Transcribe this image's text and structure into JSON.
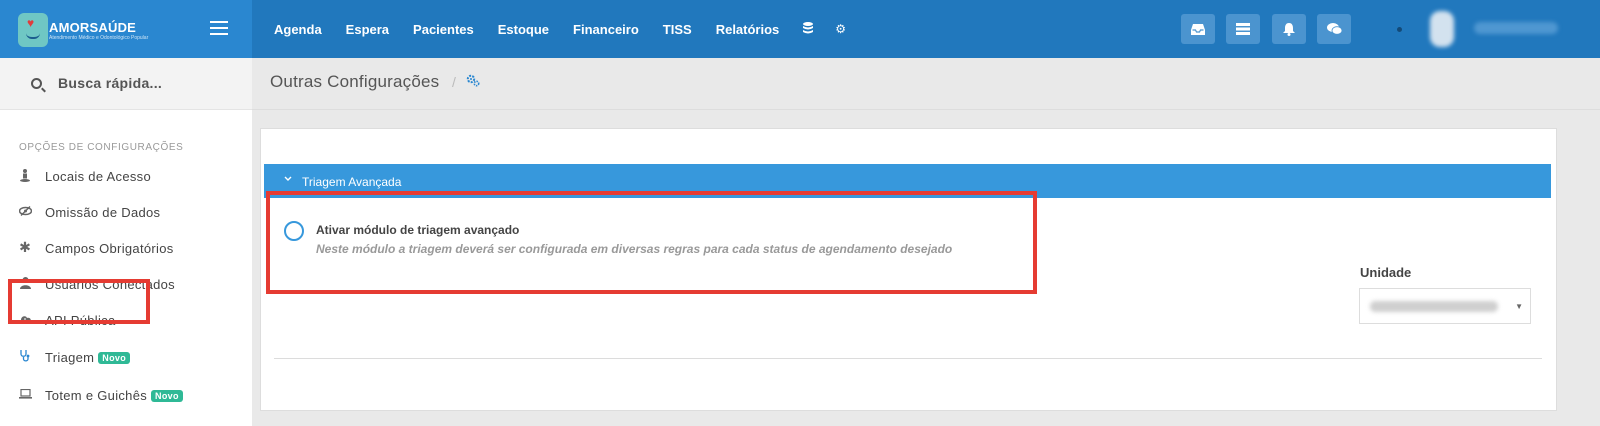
{
  "brand": {
    "name": "AMORSAÚDE",
    "subtitle": "Atendimento Médico e Odontológico Popular"
  },
  "nav": {
    "items": [
      "Agenda",
      "Espera",
      "Pacientes",
      "Estoque",
      "Financeiro",
      "TISS",
      "Relatórios"
    ],
    "icons": [
      "database-icon",
      "gear-icon"
    ]
  },
  "toolbar": {
    "buttons": [
      "inbox-icon",
      "server-icon",
      "bell-icon",
      "chat-icon"
    ]
  },
  "sidebar": {
    "search_label": "Busca rápida...",
    "section_title": "OPÇÕES DE CONFIGURAÇÕES",
    "items": [
      {
        "label": "Locais de Acesso",
        "icon": "street-view-icon"
      },
      {
        "label": "Omissão de Dados",
        "icon": "eye-slash-icon"
      },
      {
        "label": "Campos Obrigatórios",
        "icon": "asterisk-icon"
      },
      {
        "label": "Usuários Conectados",
        "icon": "user-icon"
      },
      {
        "label": "API Pública",
        "icon": "cloud-download-icon"
      },
      {
        "label": "Triagem",
        "icon": "stethoscope-icon",
        "badge": "Novo"
      },
      {
        "label": "Totem e Guichês",
        "icon": "laptop-icon",
        "badge": "Novo"
      }
    ]
  },
  "header": {
    "title": "Outras Configurações",
    "separator": "/"
  },
  "accordion": {
    "title": "Triagem Avançada"
  },
  "option": {
    "title": "Ativar módulo de triagem avançado",
    "description": "Neste módulo a triagem deverá ser configurada em diversas regras para cada status de agendamento desejado",
    "checked": false
  },
  "unit": {
    "label": "Unidade"
  },
  "colors": {
    "topbar": "#2178bd",
    "accent": "#3798dc",
    "highlight": "#e53b32",
    "badge": "#2fb996"
  }
}
